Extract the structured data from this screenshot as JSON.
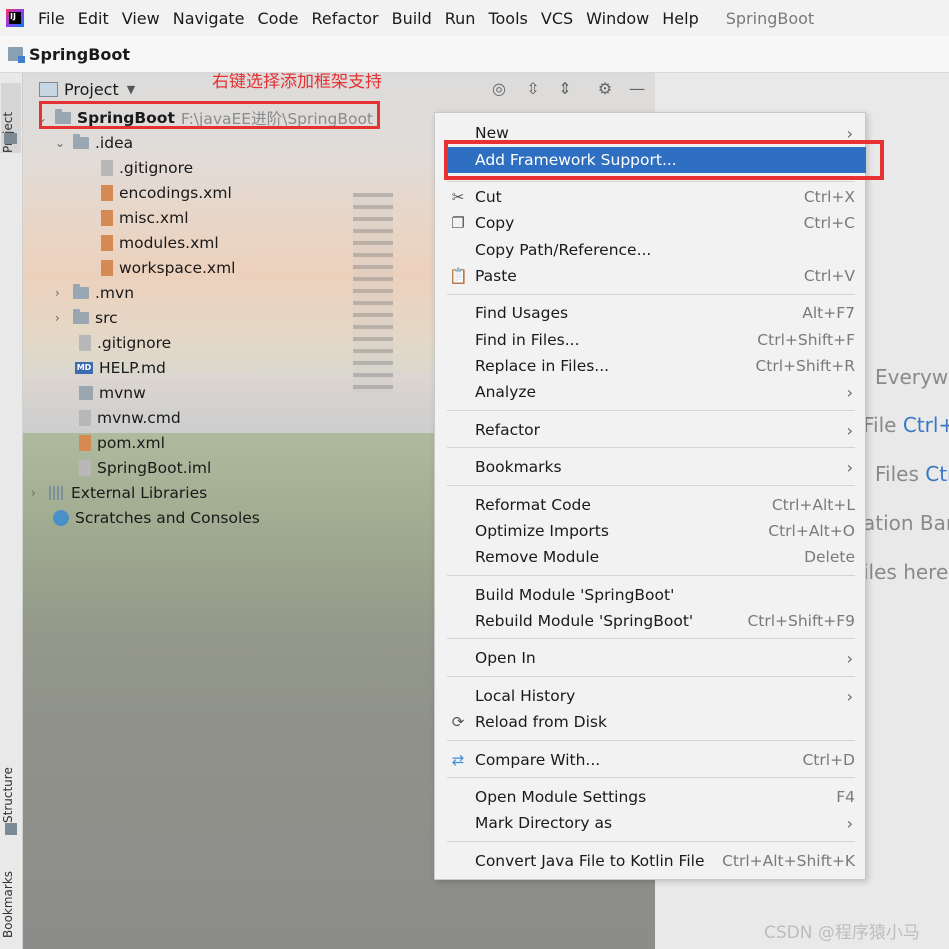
{
  "menubar": {
    "items": [
      "File",
      "Edit",
      "View",
      "Navigate",
      "Code",
      "Refactor",
      "Build",
      "Run",
      "Tools",
      "VCS",
      "Window",
      "Help"
    ],
    "project_name": "SpringBoot"
  },
  "navbar": {
    "title": "SpringBoot"
  },
  "tool_strip": {
    "project_tab": "Project",
    "structure_tab": "Structure",
    "bookmarks_tab": "Bookmarks"
  },
  "panel": {
    "title": "Project",
    "annotation": "右键选择添加框架支持"
  },
  "tree": {
    "root_name": "SpringBoot",
    "root_path": "F:\\javaEE进阶\\SpringBoot",
    "idea": ".idea",
    "idea_children": [
      ".gitignore",
      "encodings.xml",
      "misc.xml",
      "modules.xml",
      "workspace.xml"
    ],
    "mvn": ".mvn",
    "src": "src",
    "files": [
      ".gitignore",
      "HELP.md",
      "mvnw",
      "mvnw.cmd",
      "pom.xml",
      "SpringBoot.iml"
    ],
    "external_libraries": "External Libraries",
    "scratches": "Scratches and Consoles"
  },
  "context_menu": {
    "new": "New",
    "add_framework": "Add Framework Support...",
    "cut": "Cut",
    "cut_sc": "Ctrl+X",
    "copy": "Copy",
    "copy_sc": "Ctrl+C",
    "copy_path": "Copy Path/Reference...",
    "paste": "Paste",
    "paste_sc": "Ctrl+V",
    "find_usages": "Find Usages",
    "find_usages_sc": "Alt+F7",
    "find_in_files": "Find in Files...",
    "find_in_files_sc": "Ctrl+Shift+F",
    "replace_in_files": "Replace in Files...",
    "replace_in_files_sc": "Ctrl+Shift+R",
    "analyze": "Analyze",
    "refactor": "Refactor",
    "bookmarks": "Bookmarks",
    "reformat": "Reformat Code",
    "reformat_sc": "Ctrl+Alt+L",
    "optimize": "Optimize Imports",
    "optimize_sc": "Ctrl+Alt+O",
    "remove_module": "Remove Module",
    "remove_module_sc": "Delete",
    "build_module": "Build Module 'SpringBoot'",
    "rebuild_module": "Rebuild Module 'SpringBoot'",
    "rebuild_module_sc": "Ctrl+Shift+F9",
    "open_in": "Open In",
    "local_history": "Local History",
    "reload": "Reload from Disk",
    "compare": "Compare With...",
    "compare_sc": "Ctrl+D",
    "module_settings": "Open Module Settings",
    "module_settings_sc": "F4",
    "mark_directory": "Mark Directory as",
    "convert": "Convert Java File to Kotlin File",
    "convert_sc": "Ctrl+Alt+Shift+K"
  },
  "right_hints": {
    "h1": "Everywh",
    "h2a": "File ",
    "h2b": "Ctrl+",
    "h3a": "Files ",
    "h3b": "Ctr",
    "h4": "ation Bar",
    "h5": "iles here"
  },
  "watermark": "CSDN @程序猿小马",
  "colors": {
    "selection": "#2f6fc1",
    "annotation": "#e63232",
    "link": "#3876c8"
  }
}
